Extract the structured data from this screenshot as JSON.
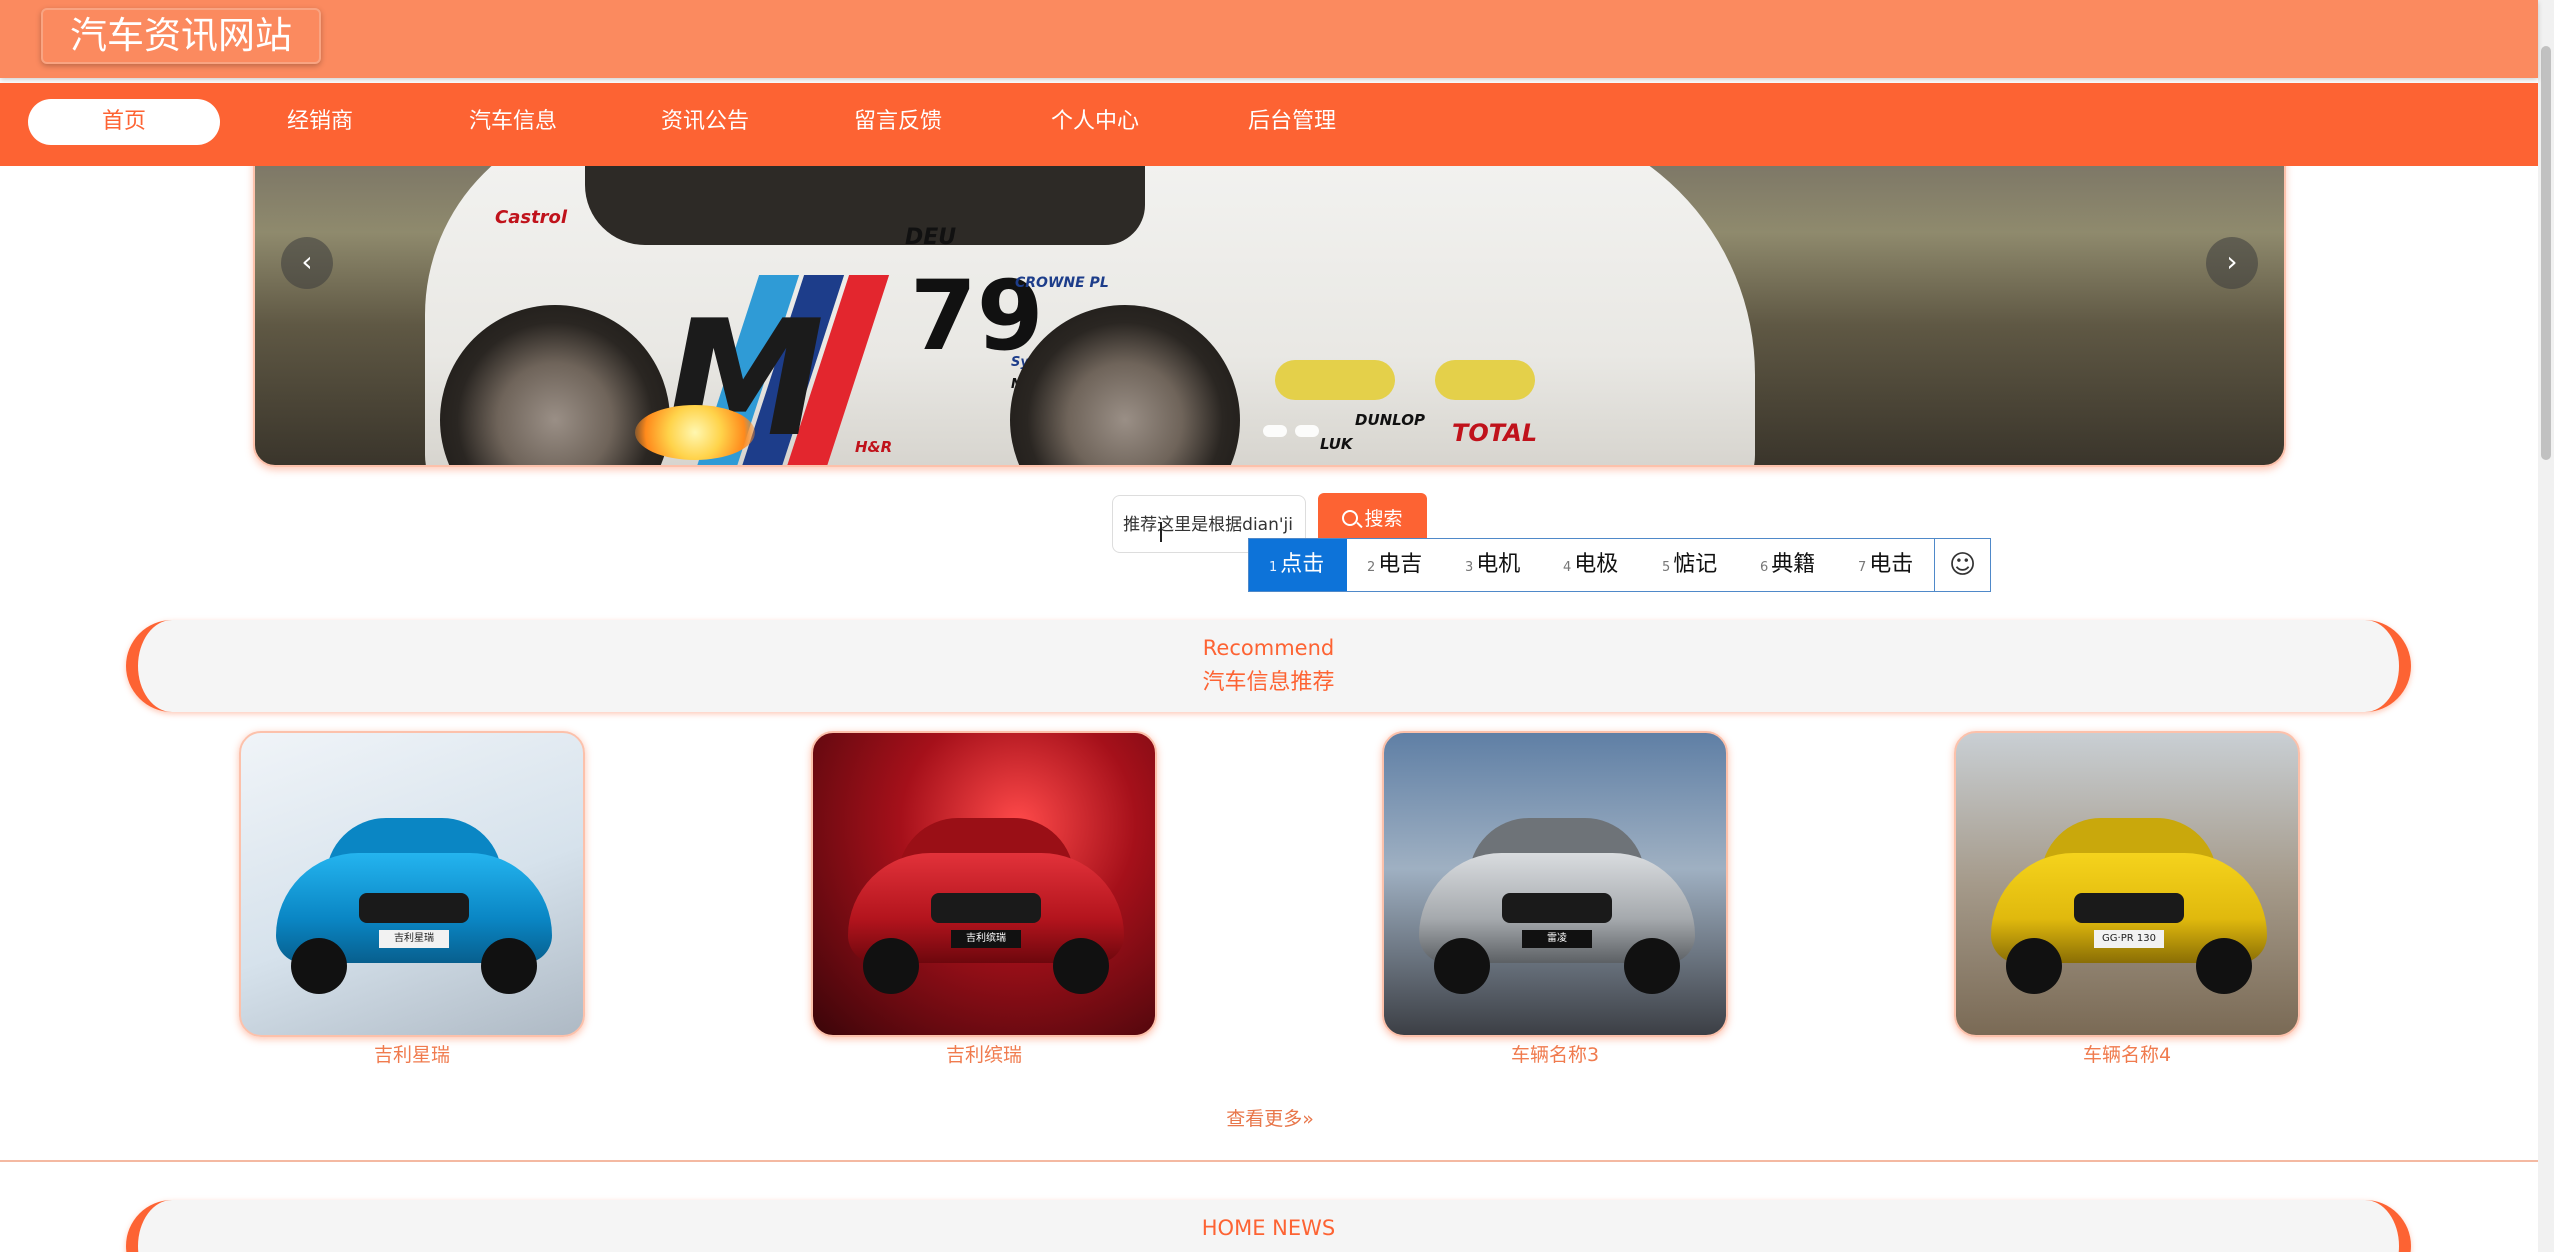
{
  "header": {
    "site_title": "汽车资讯网站"
  },
  "nav": {
    "items": [
      {
        "label": "首页",
        "active": true
      },
      {
        "label": "经销商"
      },
      {
        "label": "汽车信息"
      },
      {
        "label": "资讯公告"
      },
      {
        "label": "留言反馈"
      },
      {
        "label": "个人中心"
      },
      {
        "label": "后台管理"
      }
    ]
  },
  "carousel": {
    "prev_icon": "‹",
    "next_icon": "›",
    "slide_count": 2,
    "active_slide": 1,
    "slide_text": {
      "number": "79",
      "country": "DEU",
      "sponsors": [
        "Castrol",
        "CROWNE PL",
        "Sympatec",
        "NGK",
        "H&R",
        "DUNLOP",
        "TOTAL",
        "LUK"
      ]
    }
  },
  "search": {
    "input_value": "推荐这里是根据dian'ji",
    "button_label": "搜索"
  },
  "ime": {
    "candidates": [
      {
        "index": "1",
        "text": "点击"
      },
      {
        "index": "2",
        "text": "电吉"
      },
      {
        "index": "3",
        "text": "电机"
      },
      {
        "index": "4",
        "text": "电极"
      },
      {
        "index": "5",
        "text": "惦记"
      },
      {
        "index": "6",
        "text": "典籍"
      },
      {
        "index": "7",
        "text": "电击"
      }
    ],
    "selected_index": 0,
    "emoji_icon": "☺"
  },
  "recommend": {
    "title_en": "Recommend",
    "title_cn": "汽车信息推荐",
    "cards": [
      {
        "caption": "吉利星瑞",
        "badge": "吉利星瑞"
      },
      {
        "caption": "吉利缤瑞",
        "badge": "吉利缤瑞"
      },
      {
        "caption": "车辆名称3",
        "badge": "雷凌"
      },
      {
        "caption": "车辆名称4",
        "badge": "GG·PR 130"
      }
    ],
    "more_label": "查看更多»"
  },
  "news": {
    "title_en": "HOME NEWS"
  },
  "colors": {
    "accent": "#fd6333",
    "header": "#fb8a5f",
    "ime_selected": "#0d73d9"
  }
}
